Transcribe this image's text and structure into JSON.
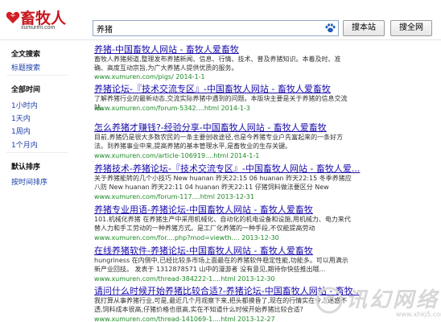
{
  "header": {
    "logo_text": "畜牧人",
    "logo_sub": "xumuren.com",
    "search_value": "养猪",
    "btn_site": "搜本站",
    "btn_web": "搜全网"
  },
  "sidebar": {
    "section1_title": "全文搜索",
    "section1_link": "标题搜索",
    "section2_title": "全部时间",
    "time_links": [
      "1小时内",
      "1天内",
      "1周内",
      "1个月内"
    ],
    "section3_title": "默认排序",
    "sort_link": "按时间排序"
  },
  "results": [
    {
      "title": "养猪-中国畜牧人网站 - 畜牧人爱畜牧",
      "snippet": "畜牧人养猪频道,整理发布养猪新闻、信息、行情、技术、普及养猪知识。本着及时、准确、高度互动宗旨,为广大养猪人提供优质的服务。",
      "url": "www.xumuren.com/pigs/ 2014-1-1"
    },
    {
      "title": "养猪论坛-『技术交流专区』-中国畜牧人网站 - 畜牧人爱畜牧",
      "snippet": "了解养猪行业的最新动态,交流实际养猪中遇到的问题。本版块主要是关于养猪的信息交流站。",
      "url": "www.xumuren.com/forum-5342....html 2014-1-3"
    },
    {
      "title": "怎么养猪才赚钱?-经验分享-中国畜牧人网站 - 畜牧人爱畜牧",
      "snippet": "目前,养猪仍是很大多数农民的一条主要创收途径,也是今养猪专业户先富起来的一条好方法。到养猪事业中来,提高养猪的基本管理水平,是畜牧业的生存关键。",
      "url": "www.xumuren.com/article-106919....html 2014-1-1"
    },
    {
      "title": "养猪技术-养猪论坛-『技术交流专区』-中国畜牧人网站 - 畜牧人爱...",
      "snippet": "关于养猪能转的几个小技巧 New huanan 昨天22:15 06 huanan 昨天22:15 冬季养猪应八防 New huanan 昨天22:11 04 huanan 昨天22:11 仔猪饲料做法要区分 New",
      "url": "www.xumuren.com/forum-117....html 2013-12-31"
    },
    {
      "title": "养猪专业用语-养猪论坛-中国畜牧人网站 - 畜牧人爱畜牧",
      "snippet": "101.机械化养猪 在养猪生产中采用机械化、自动化的机电设备和设施,用机械力、电力来代替人力和手工劳动的一种养猪方式。是工厂化养猪的一种手段,不仅能提高劳动",
      "url": "www.xumuren.com/for....php?mod=viewth.... 2013-12-30"
    },
    {
      "title": "在线养猪软件-养猪论坛-中国畜牧人网站 - 畜牧人爱畜牧",
      "snippet": "hungriness 在内侧中,已经比较多市场上面最在的养猪软件稳定性能,功能多。可以用满示新产业回技。 发表于 1312878571 山中的漫游者 没有意见,期待你快些推出哦...",
      "url": "www.xumuren.com/thread-384222-1....html 2013-12-30"
    },
    {
      "title": "请问什么时候开始养猪比较合适?-养猪论坛-中国畜牧人网站 - 畜牧...",
      "snippet": "我打算从事养猪行业,可是,最近几个月观察下来,把头都摸昏了,现在的行情实在令人迷惑不透,饲料成本很高,仔猪价格也很高,实在不知道什么时候开始养猪比较合适?",
      "url": "www.xumuren.com/thread-141069-1....html 2013-12-27"
    }
  ],
  "watermark": {
    "text": "讯幻网络",
    "url": "www.xhkj5.com"
  }
}
